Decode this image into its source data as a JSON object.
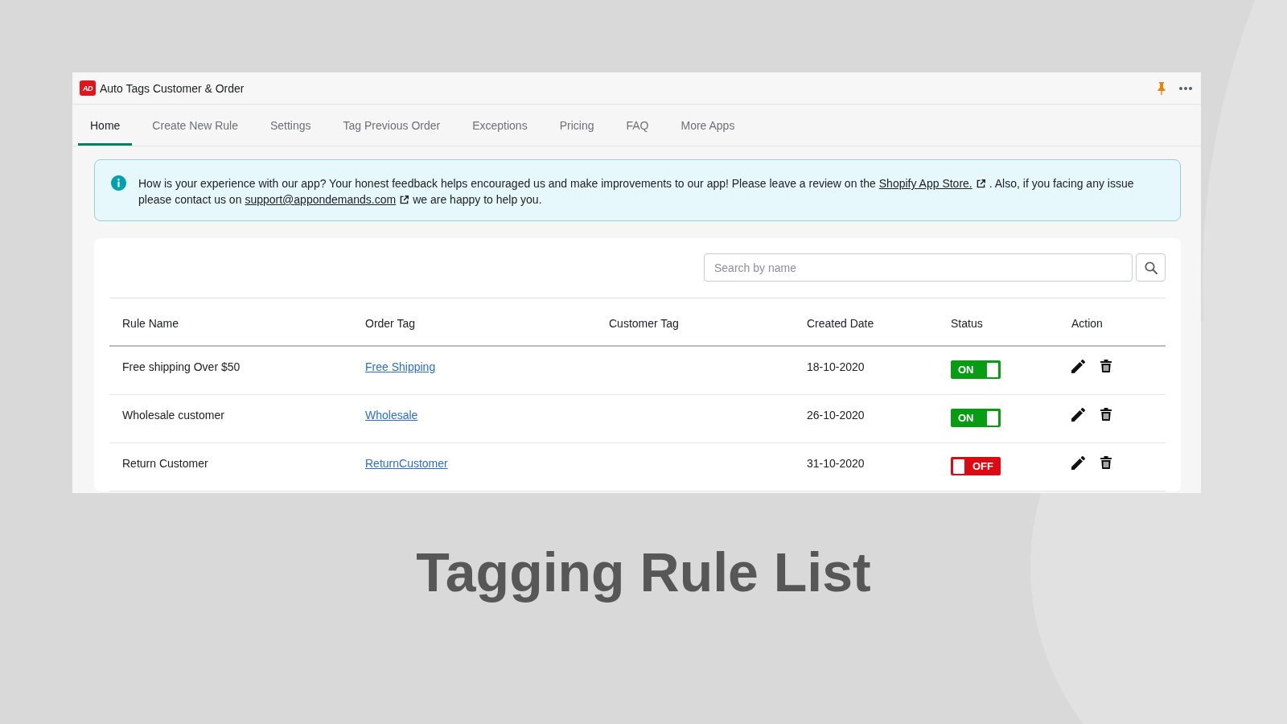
{
  "app": {
    "logo": "AD",
    "title": "Auto Tags Customer & Order"
  },
  "tabs": [
    {
      "label": "Home",
      "selected": true
    },
    {
      "label": "Create New Rule",
      "selected": false
    },
    {
      "label": "Settings",
      "selected": false
    },
    {
      "label": "Tag Previous Order",
      "selected": false
    },
    {
      "label": "Exceptions",
      "selected": false
    },
    {
      "label": "Pricing",
      "selected": false
    },
    {
      "label": "FAQ",
      "selected": false
    },
    {
      "label": "More Apps",
      "selected": false
    }
  ],
  "banner": {
    "parts": [
      {
        "kind": "text",
        "text": "How is your experience with our app? Your honest feedback helps encouraged us and make improvements to our app! Please leave a review on the"
      },
      {
        "kind": "link",
        "text": "Shopify App Store."
      },
      {
        "kind": "text",
        "text": ". Also, if you facing any issue please contact us on"
      },
      {
        "kind": "link",
        "text": "support@appondemands.com"
      },
      {
        "kind": "text",
        "text": "we are happy to help you."
      }
    ]
  },
  "search": {
    "placeholder": "Search by name"
  },
  "table": {
    "columns": [
      "Rule Name",
      "Order Tag",
      "Customer Tag",
      "Created Date",
      "Status",
      "Action"
    ],
    "rows": [
      {
        "rule_name": "Free shipping Over $50",
        "order_tag": "Free Shipping",
        "created_date": "18-10-2020",
        "status": {
          "label": "ON",
          "on": true
        }
      },
      {
        "rule_name": "Wholesale customer",
        "order_tag": "Wholesale",
        "created_date": "26-10-2020",
        "status": {
          "label": "ON",
          "on": true
        }
      },
      {
        "rule_name": "Return Customer",
        "order_tag": "ReturnCustomer",
        "created_date": "31-10-2020",
        "status": {
          "label": "OFF",
          "on": false
        }
      }
    ]
  },
  "caption": "Tagging Rule List"
}
